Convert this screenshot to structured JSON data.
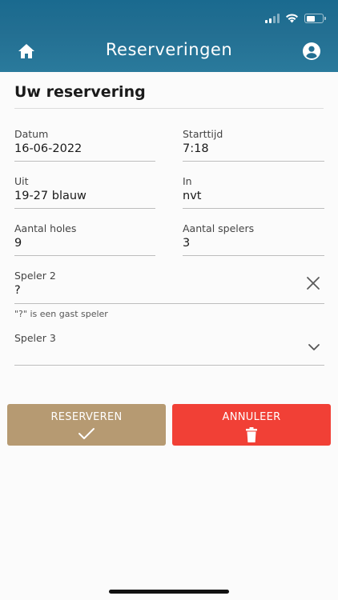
{
  "header": {
    "title": "Reserveringen"
  },
  "section": {
    "title": "Uw reservering"
  },
  "fields": {
    "datum": {
      "label": "Datum",
      "value": "16-06-2022"
    },
    "starttijd": {
      "label": "Starttijd",
      "value": "7:18"
    },
    "uit": {
      "label": "Uit",
      "value": "19-27 blauw"
    },
    "in": {
      "label": "In",
      "value": "nvt"
    },
    "aantal_holes": {
      "label": "Aantal holes",
      "value": "9"
    },
    "aantal_spelers": {
      "label": "Aantal spelers",
      "value": "3"
    },
    "speler2": {
      "label": "Speler 2",
      "value": "?"
    },
    "speler3": {
      "label": "Speler 3",
      "value": ""
    }
  },
  "hint": "\"?\" is een gast speler",
  "buttons": {
    "reserve": {
      "label": "RESERVEREN"
    },
    "cancel": {
      "label": "ANNULEER"
    }
  },
  "colors": {
    "header": "#236f92",
    "reserve": "#b69a72",
    "cancel": "#f14036"
  },
  "icons": [
    "home-icon",
    "account-circle-icon",
    "close-icon",
    "chevron-down-icon",
    "checkmark-icon",
    "trash-icon",
    "cellular-signal-icon",
    "wifi-icon",
    "battery-icon"
  ]
}
